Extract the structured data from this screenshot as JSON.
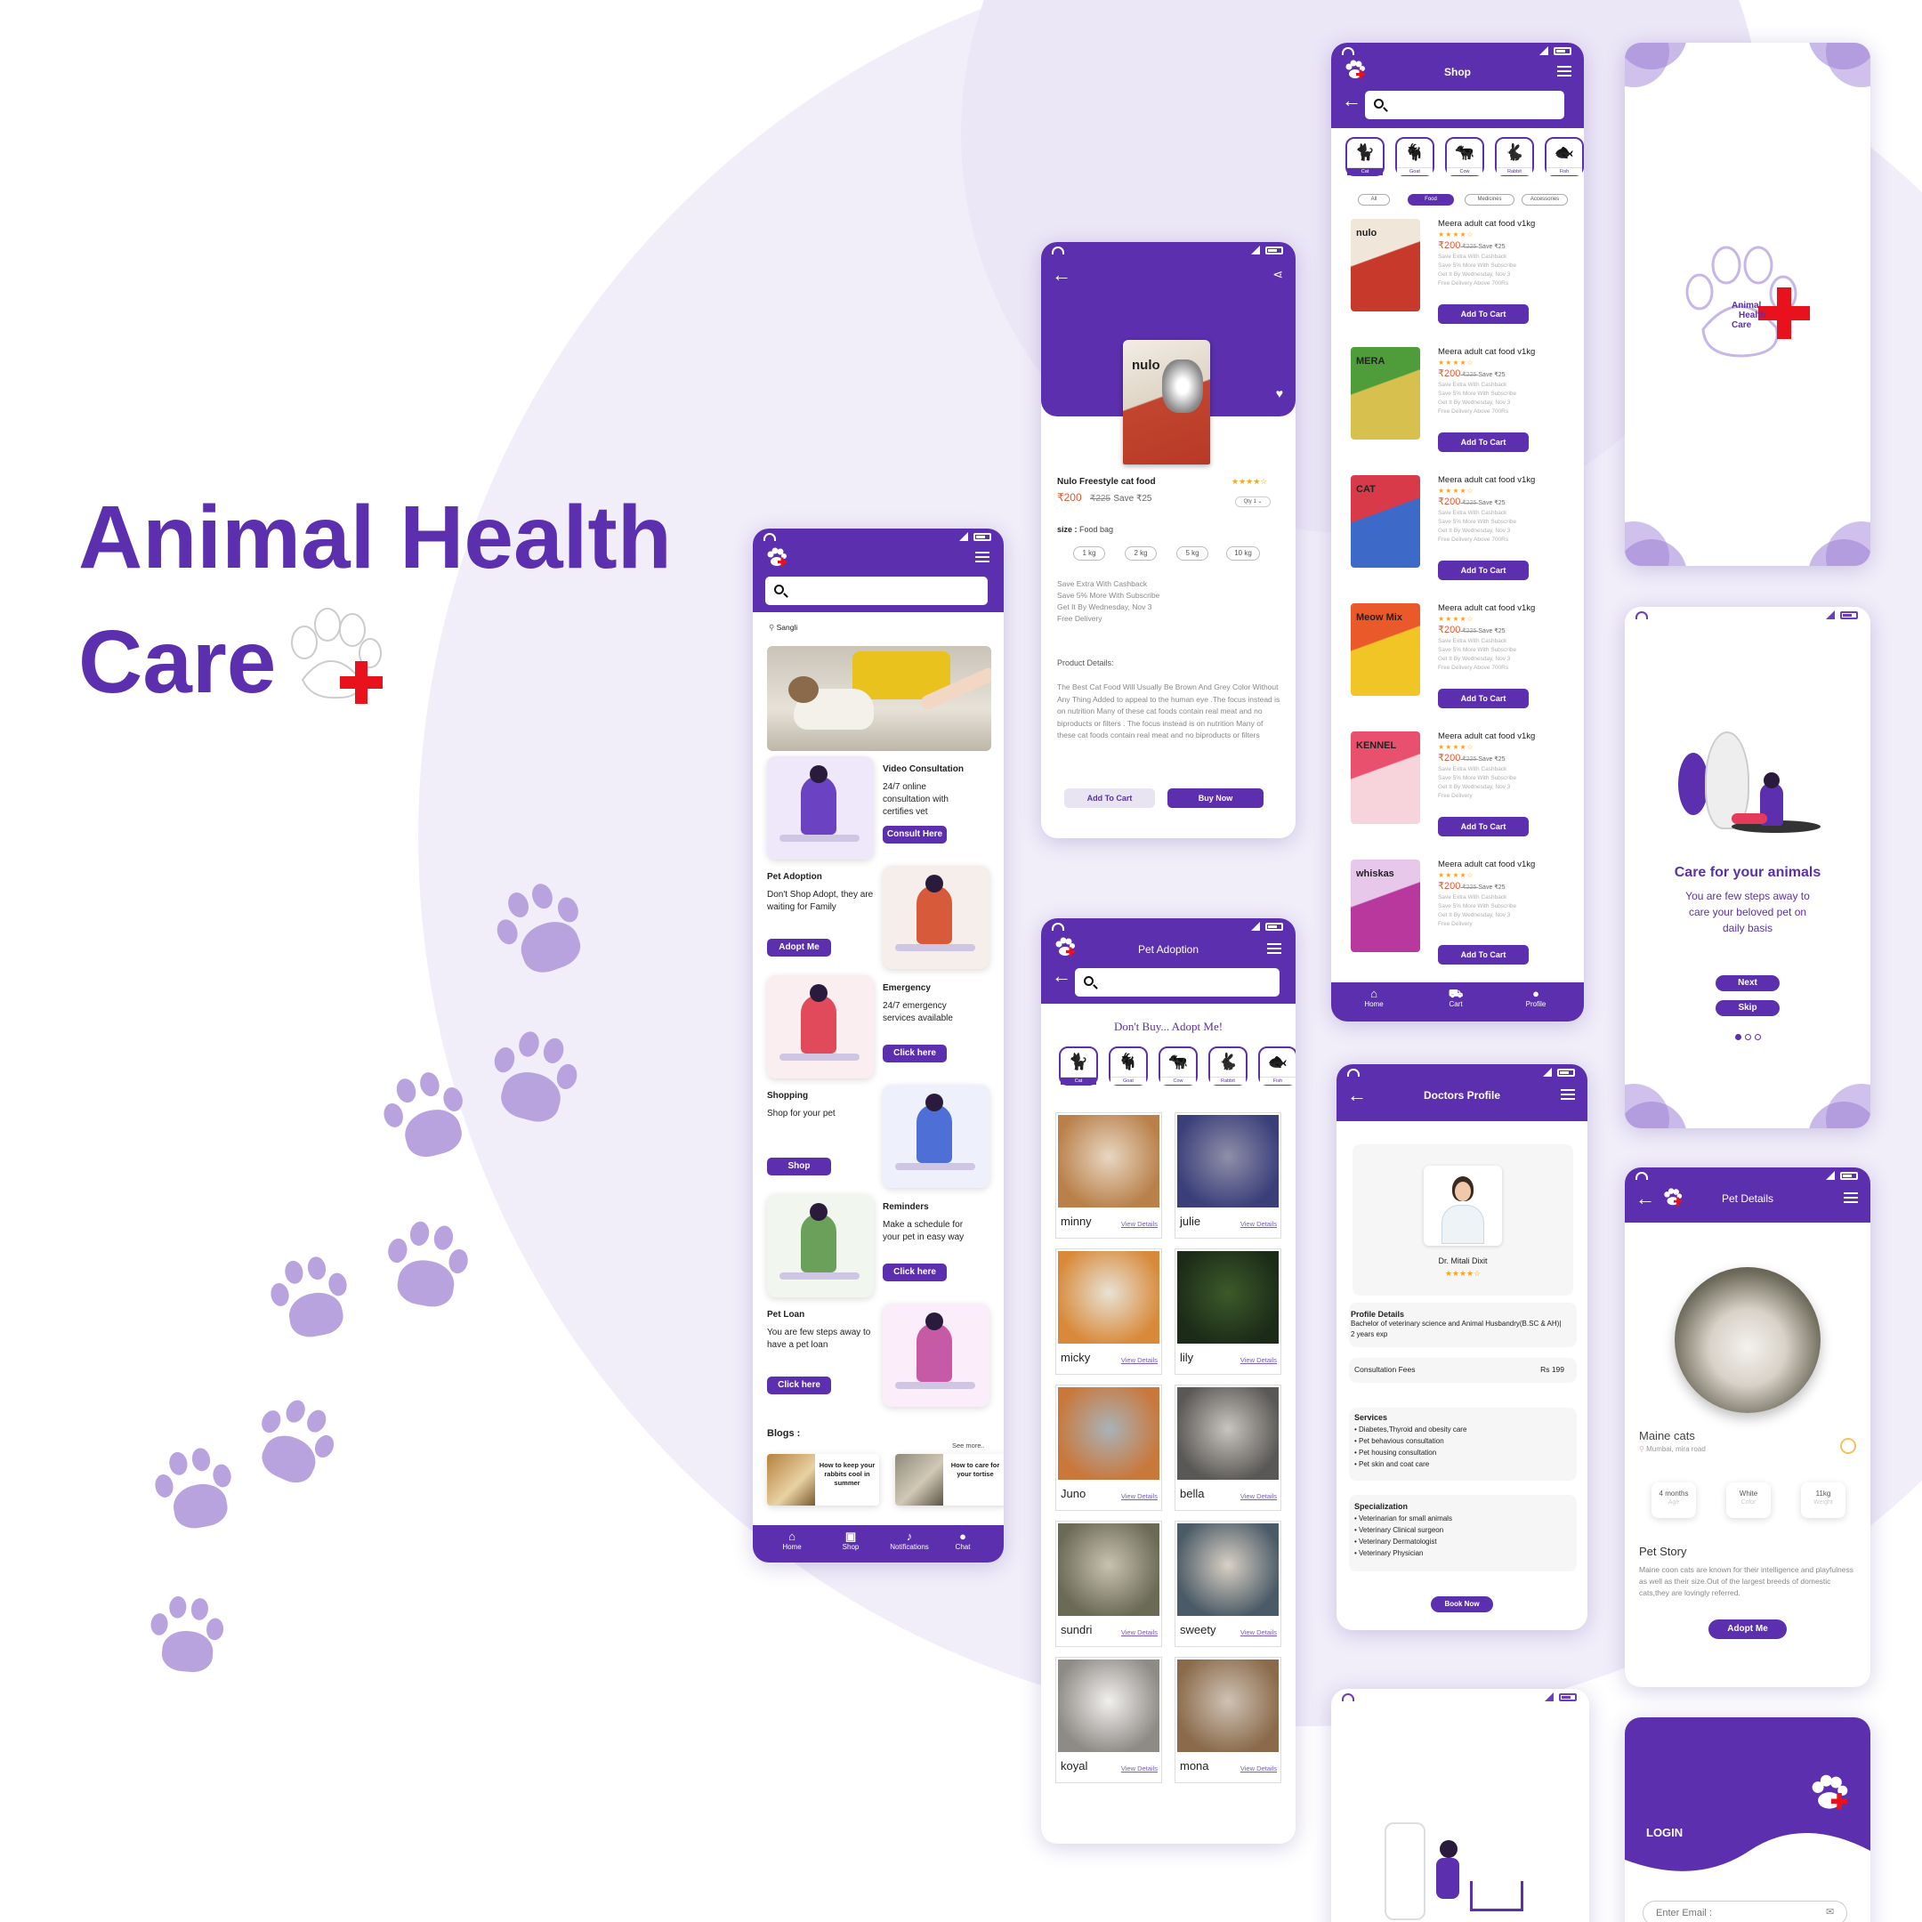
{
  "brand": {
    "title_line1": "Animal Health",
    "title_line2": "Care",
    "accent": "#5b2fae",
    "red": "#e8121c"
  },
  "home": {
    "location": "Sangli",
    "cards": [
      {
        "title": "Video  Consultation",
        "text": "24/7 online consultation with certifies vet",
        "button": "Consult Here"
      },
      {
        "title": "Pet Adoption",
        "text": "Don't Shop Adopt, they are waiting for Family",
        "button": "Adopt Me"
      },
      {
        "title": "Emergency",
        "text": "24/7 emergency services available",
        "button": "Click here"
      },
      {
        "title": "Shopping",
        "text": "Shop for your pet",
        "button": "Shop"
      },
      {
        "title": "Reminders",
        "text": "Make a schedule for your pet in  easy way",
        "button": "Click here"
      },
      {
        "title": "Pet Loan",
        "text": "You are few steps away to have a pet loan",
        "button": "Click here"
      }
    ],
    "blogs_label": "Blogs :",
    "see_more": "See more..",
    "blogs": [
      "How to keep your rabbits cool in summer",
      "How to care for your tortise"
    ],
    "nav": [
      "Home",
      "Shop",
      "Notifications",
      "Chat"
    ]
  },
  "product": {
    "name": "Nulo Freestyle cat food",
    "stars": "★★★★☆",
    "price": "₹200",
    "old_price": "₹225",
    "save": "Save ₹25",
    "qty": "Qty 1",
    "size_label": "size :",
    "size_value": "Food bag",
    "sizes": [
      "1 kg",
      "2 kg",
      "5 kg",
      "10 kg"
    ],
    "offers": [
      "Save Extra With Cashback",
      "Save 5% More With Subscribe",
      "Get It By Wednesday, Nov 3",
      "Free Delivery"
    ],
    "details_label": "Product Details:",
    "details": "The Best Cat Food Will Usually Be Brown And Grey Color Without Any Thing Added to appeal to the human eye .The focus instead is on nutrition Many of these cat foods contain real meat and no biproducts or filters . The focus instead is on nutrition Many of these cat foods contain real meat and no biproducts or filters",
    "add_cart": "Add To Cart",
    "buy_now": "Buy Now"
  },
  "adoption": {
    "title": "Pet Adoption",
    "tagline": "Don't Buy... Adopt Me!",
    "categories": [
      "Cat",
      "Goat",
      "Cow",
      "Rabbit",
      "Fish"
    ],
    "view": "View Details",
    "pets": [
      "minny",
      "julie",
      "micky",
      "lily",
      "Juno",
      "bella",
      "sundri",
      "sweety",
      "koyal",
      "mona"
    ]
  },
  "shop": {
    "title": "Shop",
    "categories": [
      "Cat",
      "Goat",
      "Cow",
      "Rabbit",
      "Fish"
    ],
    "filters": [
      "All",
      "Food",
      "Medicines",
      "Accessories"
    ],
    "item_name": "Meera adult cat food v1kg",
    "stars": "★★★★☆",
    "price": "₹200",
    "old_price": "₹225",
    "save": "Save ₹25",
    "item_desc": [
      "Save Extra With Cashback",
      "Save 5% More With Subscribe",
      "Get It By Wednesday, Nov 3",
      "Free Delivery  Above 700Rs"
    ],
    "add_cart": "Add To Cart",
    "brands": [
      "nulo",
      "MERA",
      "CAT",
      "Meow Mix",
      "KENNEL",
      "whiskas"
    ],
    "nav": [
      "Home",
      "Cart",
      "Profile"
    ]
  },
  "doctor": {
    "title": "Doctors Profile",
    "name": "Dr. Mitali Dixit",
    "stars": "★★★★☆",
    "profile_label": "Profile  Details",
    "profile_text": "Bachelor of veterinary science and Animal Husbandry(B.SC & AH)| 2 years  exp",
    "fees_label": "Consultation Fees",
    "fees": "Rs 199",
    "services_label": "Services",
    "services": [
      "Diabetes,Thyroid and obesity care",
      "Pet behavious consultation",
      "Pet housing consultation",
      "Pet skin and coat care"
    ],
    "spec_label": "Specialization",
    "spec": [
      "Veterinarian for small animals",
      "Veterinary Clinical surgeon",
      "Veterinary Dermatologist",
      "Veterinary Physician"
    ],
    "book": "Book Now"
  },
  "splash": {
    "logo_line1": "Animal",
    "logo_line2": "Health",
    "logo_line3": "Care"
  },
  "onboard": {
    "title": "Care for your animals",
    "text": "You are few steps away to care your beloved pet on daily basis",
    "next": "Next",
    "skip": "Skip"
  },
  "petdetail": {
    "title": "Pet Details",
    "name": "Maine cats",
    "location": "Mumbai, mira road",
    "stats": [
      {
        "value": "4 months",
        "label": "Age"
      },
      {
        "value": "White",
        "label": "Color"
      },
      {
        "value": "11kg",
        "label": "Weight"
      }
    ],
    "story_label": "Pet Story",
    "story": "Maine coon cats are known for their intelligence and playfulness as well as their size.Out of the largest breeds of domestic cats,they are lovingly referred.",
    "button": "Adopt Me"
  },
  "login": {
    "title": "LOGIN",
    "placeholder": "Enter Email :"
  }
}
